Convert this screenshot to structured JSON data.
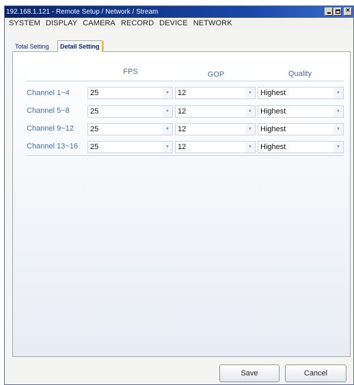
{
  "window": {
    "title": "192.168.1.121 - Remote Setup / Network / Stream"
  },
  "menu": [
    "SYSTEM",
    "DISPLAY",
    "CAMERA",
    "RECORD",
    "DEVICE",
    "NETWORK"
  ],
  "tabs": {
    "total": "Total Setting",
    "detail": "Detail Setting",
    "active": "Detail Setting"
  },
  "headers": {
    "fps": "FPS",
    "gop": "GOP",
    "quality": "Quality"
  },
  "rows": [
    {
      "label": "Channel 1~4",
      "fps": "25",
      "gop": "12",
      "quality": "Highest"
    },
    {
      "label": "Channel 5~8",
      "fps": "25",
      "gop": "12",
      "quality": "Highest"
    },
    {
      "label": "Channel 9~12",
      "fps": "25",
      "gop": "12",
      "quality": "Highest"
    },
    {
      "label": "Channel 13~16",
      "fps": "25",
      "gop": "12",
      "quality": "Highest"
    }
  ],
  "buttons": {
    "save": "Save",
    "cancel": "Cancel"
  },
  "colors": {
    "titlebar": "#0a246a",
    "label_text": "#4a6fa0",
    "active_tab_marker": "#ffcc33"
  }
}
